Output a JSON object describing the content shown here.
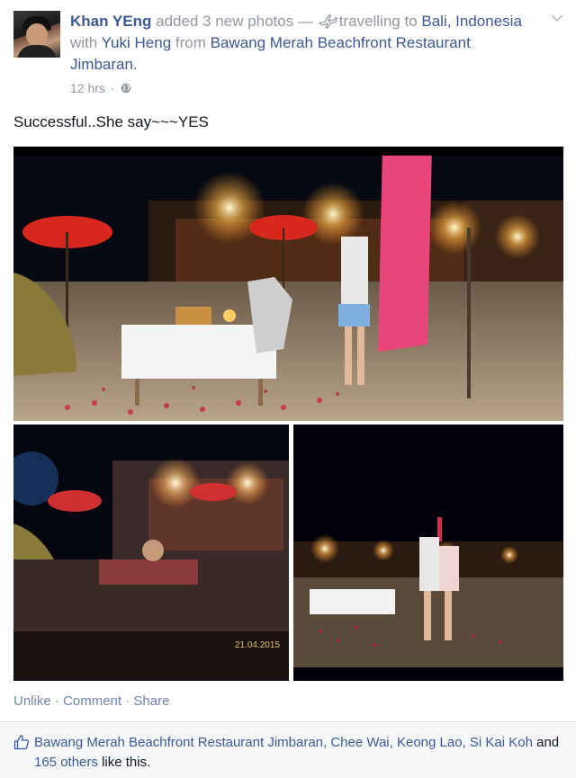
{
  "post": {
    "author": "Khan YEng",
    "action": "added 3 new photos —",
    "activity": "travelling to",
    "destination": "Bali, Indonesia",
    "with_word": "with",
    "tagged": "Yuki Heng",
    "from_word": "from",
    "location": "Bawang Merah Beachfront Restaurant Jimbaran.",
    "time": "12 hrs",
    "separator": "·",
    "status_text": "Successful..She say~~~YES",
    "photos": [
      {
        "alt": "Night dinner setup on beach with man kneeling proposing"
      },
      {
        "alt": "Candlelit dinner table at beachfront restaurant",
        "stamp": "21.04.2015"
      },
      {
        "alt": "Couple hugging on beach at night"
      }
    ],
    "icons": {
      "privacy": "globe-icon",
      "activity": "airplane-icon",
      "menu": "chevron-down-icon",
      "like": "thumbs-up-icon"
    }
  },
  "actions": {
    "unlike": "Unlike",
    "comment": "Comment",
    "share": "Share",
    "dot": "·"
  },
  "likes": {
    "people": "Bawang Merah Beachfront Restaurant Jimbaran, Chee Wai, Keong Lao, Si Kai Koh",
    "and_word": "and",
    "others": "165 others",
    "suffix": "like this."
  },
  "colors": {
    "link": "#3b5998",
    "muted": "#9197a3",
    "likes_bg": "#f6f7f9"
  }
}
